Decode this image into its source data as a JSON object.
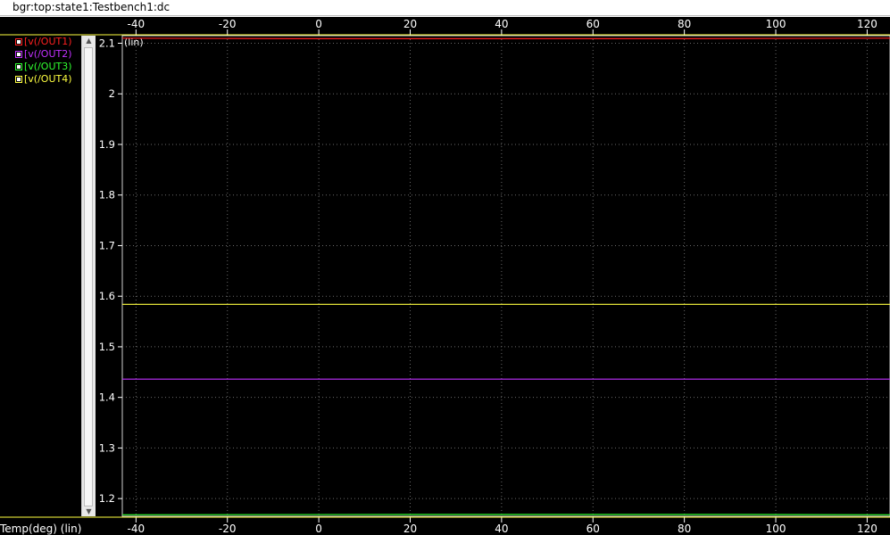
{
  "window": {
    "title": "bgr:top:state1:Testbench1:dc"
  },
  "legend": {
    "items": [
      {
        "label": "[v(/OUT1)",
        "color": "#ff2020"
      },
      {
        "label": "[v(/OUT2)",
        "color": "#c030ff"
      },
      {
        "label": "[v(/OUT3)",
        "color": "#30ff30"
      },
      {
        "label": "[v(/OUT4)",
        "color": "#ffff40"
      }
    ]
  },
  "y_axis": {
    "scale_label": "(lin)"
  },
  "x_axis": {
    "label": "Temp(deg) (lin)"
  },
  "chart_data": {
    "type": "line",
    "title": "",
    "xlabel": "Temp(deg) (lin)",
    "ylabel": "",
    "xlim": [
      -43,
      125
    ],
    "ylim": [
      1.165,
      2.115
    ],
    "x_ticks": [
      -40,
      -20,
      0,
      20,
      40,
      60,
      80,
      100,
      120
    ],
    "x_tick_labels": [
      "-40",
      "-20",
      "0",
      "20",
      "40",
      "60",
      "80",
      "100",
      "120"
    ],
    "y_ticks": [
      1.2,
      1.3,
      1.4,
      1.5,
      1.6,
      1.7,
      1.8,
      1.9,
      2.0,
      2.1
    ],
    "y_tick_labels": [
      "1.2",
      "1.3",
      "1.4",
      "1.5",
      "1.6",
      "1.7",
      "1.8",
      "1.9",
      "2",
      "2.1"
    ],
    "grid": true,
    "legend_position": "left",
    "series": [
      {
        "name": "[v(/OUT1)",
        "color": "#ff2020",
        "x": [
          -43,
          -5,
          78,
          125
        ],
        "y": [
          2.11,
          2.109,
          2.109,
          2.11
        ]
      },
      {
        "name": "[v(/OUT2)",
        "color": "#c030ff",
        "x": [
          -43,
          125
        ],
        "y": [
          1.436,
          1.436
        ]
      },
      {
        "name": "[v(/OUT3)",
        "color": "#30ff30",
        "x": [
          -43,
          20,
          95,
          125
        ],
        "y": [
          1.168,
          1.1685,
          1.1685,
          1.168
        ]
      },
      {
        "name": "[v(/OUT4)",
        "color": "#ffff40",
        "x": [
          -43,
          125
        ],
        "y": [
          1.584,
          1.584
        ]
      }
    ]
  }
}
